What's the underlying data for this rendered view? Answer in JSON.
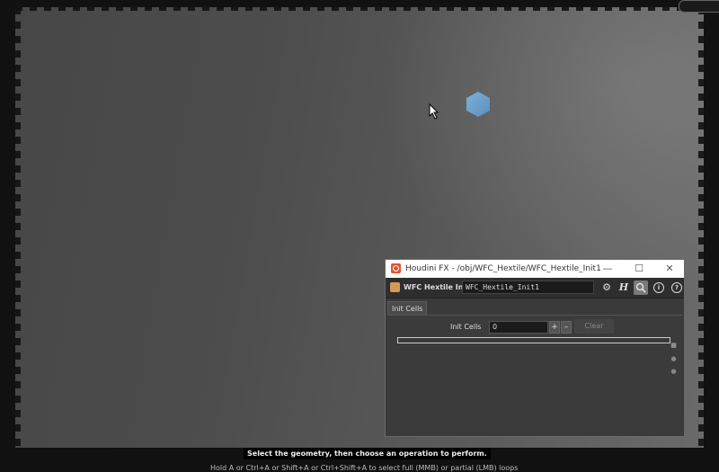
{
  "viewport": {
    "status_message": "Select the geometry, then choose an operation to perform.",
    "status_hint": "Hold A or Ctrl+A or Shift+A or Ctrl+Shift+A to select full (MMB) or partial (LMB) loops"
  },
  "dialog": {
    "window_title": "Houdini FX - /obj/WFC_Hextile/WFC_Hextile_Init1",
    "minimize": "—",
    "maximize": "☐",
    "close": "✕",
    "node_type_label": "WFC Hextile Init",
    "node_name": "WFC_Hextile_Init1",
    "tabs": [
      "Init Cells"
    ],
    "parm": {
      "label": "Init Cells",
      "value": "0",
      "plus": "+",
      "minus": "–",
      "clear_label": "Clear"
    },
    "toolbar_icons": [
      "gear-icon",
      "hscript-icon",
      "search-icon",
      "info-icon",
      "help-icon"
    ]
  },
  "colors": {
    "accent_houdini": "#e2552b",
    "hex_object": "#6a9ecb"
  }
}
